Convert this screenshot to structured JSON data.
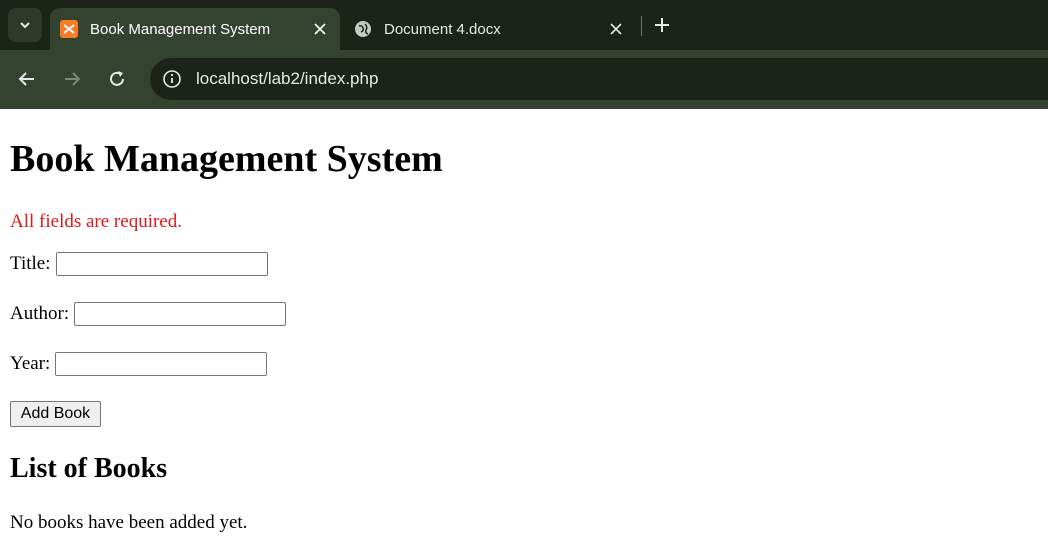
{
  "browser": {
    "tabs": [
      {
        "title": "Book Management System",
        "active": true,
        "favicon": "xampp-icon"
      },
      {
        "title": "Document 4.docx",
        "active": false,
        "favicon": "globe-icon"
      }
    ],
    "address": "localhost/lab2/index.php",
    "colors": {
      "frame": "#1a2417",
      "toolbar": "#344230"
    }
  },
  "page": {
    "heading": "Book Management System",
    "error": "All fields are required.",
    "form": {
      "title_label": "Title:",
      "title_value": "",
      "author_label": "Author:",
      "author_value": "",
      "year_label": "Year:",
      "year_value": "",
      "submit_label": "Add Book"
    },
    "list_heading": "List of Books",
    "empty_message": "No books have been added yet.",
    "colors": {
      "error": "#e0161b"
    }
  }
}
